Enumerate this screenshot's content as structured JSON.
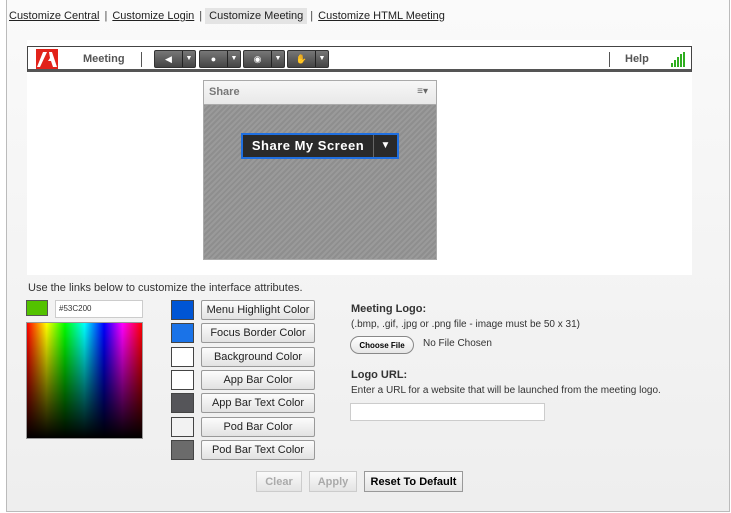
{
  "nav": {
    "items": [
      "Customize Central",
      "Customize Login",
      "Customize Meeting",
      "Customize HTML Meeting"
    ],
    "separator": "|"
  },
  "appbar": {
    "title": "Meeting",
    "help": "Help",
    "tools": [
      "speaker-icon",
      "microphone-icon",
      "webcam-icon",
      "raise-hand-icon"
    ]
  },
  "pod": {
    "title": "Share",
    "menu": "≡▾",
    "share_button": "Share My Screen",
    "dropdown": "▼"
  },
  "intro": "Use the links below to customize the interface attributes.",
  "picker": {
    "current_color": "#53C200",
    "hex_value": "#53C200"
  },
  "colors": [
    {
      "label": "Menu Highlight Color",
      "color": "#0055d4"
    },
    {
      "label": "Focus Border Color",
      "color": "#1a73e8"
    },
    {
      "label": "Background Color",
      "color": "#ffffff"
    },
    {
      "label": "App Bar Color",
      "color": "#ffffff"
    },
    {
      "label": "App Bar Text Color",
      "color": "#555559"
    },
    {
      "label": "Pod Bar Color",
      "color": "#f2f2f2"
    },
    {
      "label": "Pod Bar Text Color",
      "color": "#6b6b6b"
    }
  ],
  "logo": {
    "label": "Meeting Logo:",
    "hint": "(.bmp, .gif, .jpg or .png file - image must be 50 x 31)",
    "choose": "Choose File",
    "status": "No File Chosen"
  },
  "logo_url": {
    "label": "Logo URL:",
    "hint": "Enter a URL for a website that will be launched from the meeting logo.",
    "value": ""
  },
  "actions": {
    "clear": "Clear",
    "apply": "Apply",
    "reset": "Reset To Default"
  }
}
